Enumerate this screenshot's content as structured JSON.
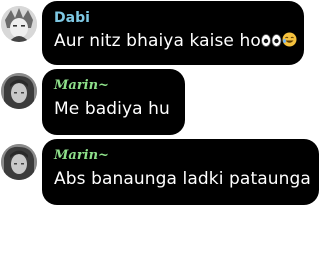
{
  "messages": [
    {
      "name": "Dabi",
      "name_color": "#7ec8e3",
      "text": "Aur nitz bhaiya kaise ho",
      "emojis": [
        "eyes-emoji",
        "laughing-emoji"
      ]
    },
    {
      "name": "Marin~",
      "name_color": "#8ee08a",
      "text": "Me badiya hu"
    },
    {
      "name": "Marin~",
      "name_color": "#8ee08a",
      "text": "Abs banaunga ladki pataunga"
    }
  ]
}
